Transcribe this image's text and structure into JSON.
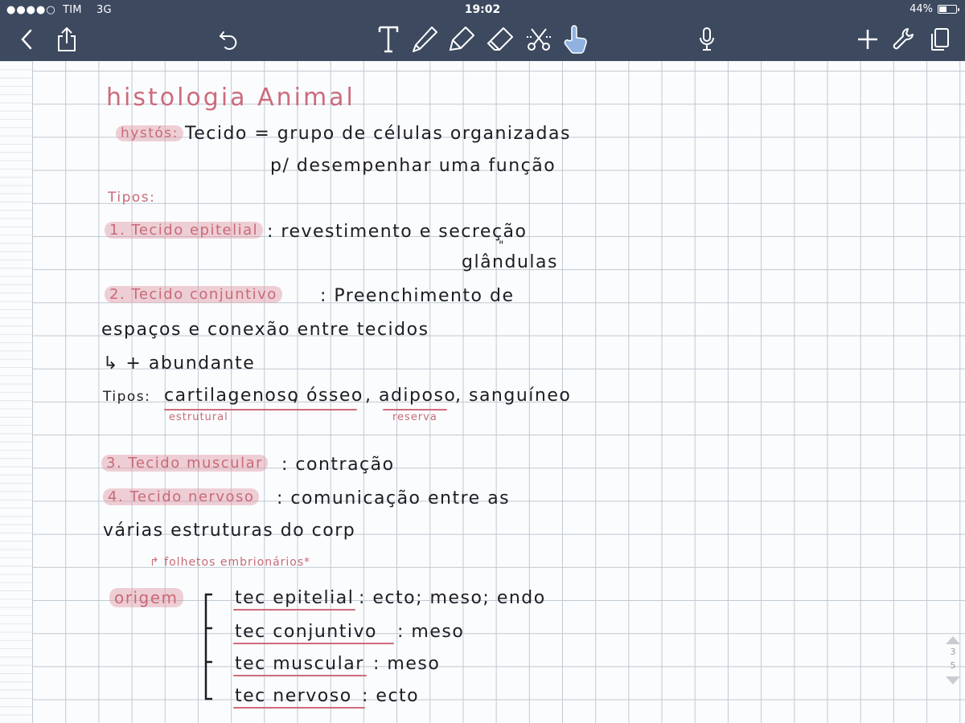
{
  "status": {
    "carrier": "TIM",
    "network": "3G",
    "time": "19:02",
    "battery": "44%",
    "battery_level": 0.44
  },
  "toolbar": {
    "icons": [
      "back-chevron-icon",
      "share-icon",
      "undo-icon",
      "text-tool-icon",
      "pen-icon",
      "highlighter-icon",
      "eraser-icon",
      "lasso-scissors-icon",
      "hand-pointer-icon",
      "microphone-icon",
      "add-icon",
      "wrench-icon",
      "pages-icon"
    ],
    "accent": "#3c495f"
  },
  "note": {
    "title": "histologia Animal",
    "hystos": "hystós:",
    "definition_1": "Tecido = grupo de células organizadas",
    "definition_2": "p/ desempenhar uma função",
    "tipos_header": "Tipos:",
    "item1_label": "1. Tecido epitelial",
    "item1_text": ": revestimento e secreção",
    "item1_sub_mark": "\"",
    "item1_sub": "glândulas",
    "item2_label": "2. Tecido conjuntivo",
    "item2_text": ": Preenchimento de",
    "item2_line2": "espaços e conexão entre tecidos",
    "item2_line3": "↳ + abundante",
    "tipos_line": "Tipos:",
    "tipo_cartilagem": "cartilagenoso",
    "tipo_osseo": ", ósseo",
    "tipo_adiposo": ", adiposo",
    "tipo_sanguineo": ", sanguíneo",
    "label_estrutural": "estrutural",
    "label_reserva": "reserva",
    "item3_label": "3. Tecido muscular",
    "item3_text": ": contração",
    "item4_label": "4. Tecido nervoso",
    "item4_text": ": comunicação entre as",
    "item4_line2": "várias estruturas do corp",
    "folhetos": "↱ folhetos embrionários*",
    "origem": "origem",
    "origem_items": [
      {
        "tec": "tec epitelial",
        "value": ": ecto; meso; endo"
      },
      {
        "tec": "tec conjuntivo",
        "value": ": meso"
      },
      {
        "tec": "tec muscular",
        "value": ": meso"
      },
      {
        "tec": "tec nervoso",
        "value": ": ecto"
      }
    ]
  },
  "pager": {
    "current": "3",
    "total": "5"
  }
}
